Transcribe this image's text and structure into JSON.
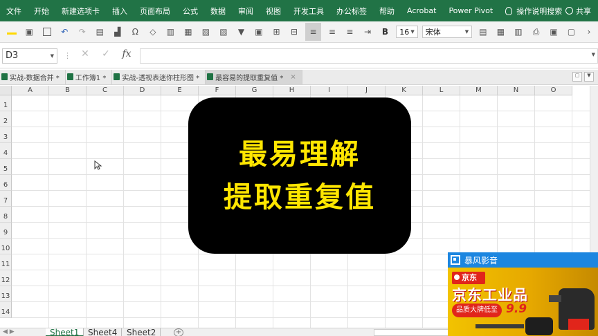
{
  "menu": {
    "items": [
      "文件",
      "开始",
      "新建选项卡",
      "插入",
      "页面布局",
      "公式",
      "数据",
      "审阅",
      "视图",
      "开发工具",
      "办公标签",
      "帮助",
      "Acrobat",
      "Power Pivot"
    ],
    "tell_me": "操作说明搜索",
    "share": "共享"
  },
  "toolbar": {
    "font_size": "16",
    "font_name": "宋体",
    "bold_label": "B"
  },
  "formula_bar": {
    "name_box": "D3",
    "value": ""
  },
  "workbook_tabs": [
    {
      "label": "实战-数据合并 *",
      "active": false
    },
    {
      "label": "工作簿1 *",
      "active": false
    },
    {
      "label": "实战-透视表迷你柱形图 *",
      "active": false
    },
    {
      "label": "最容易的提取重复值 *",
      "active": true
    }
  ],
  "grid": {
    "columns": [
      "A",
      "B",
      "C",
      "D",
      "E",
      "F",
      "G",
      "H",
      "I",
      "J",
      "K",
      "L",
      "M",
      "N",
      "O"
    ],
    "rows": [
      "1",
      "2",
      "3",
      "4",
      "5",
      "6",
      "7",
      "8",
      "9",
      "10",
      "11",
      "12",
      "13",
      "14"
    ]
  },
  "callout": {
    "line1": "最易理解",
    "line2": "提取重复值"
  },
  "sheet_tabs": [
    {
      "label": "Sheet1",
      "active": true
    },
    {
      "label": "Sheet4",
      "active": false
    },
    {
      "label": "Sheet2",
      "active": false
    }
  ],
  "ad": {
    "header": "暴风影音",
    "brand": "京东",
    "headline": "京东工业品",
    "tagline": "品质大牌低至",
    "price": "9.9"
  },
  "colors": {
    "ribbon": "#217346",
    "callout_bg": "#000000",
    "callout_text": "#ffe600",
    "ad_header": "#1c86e0"
  }
}
